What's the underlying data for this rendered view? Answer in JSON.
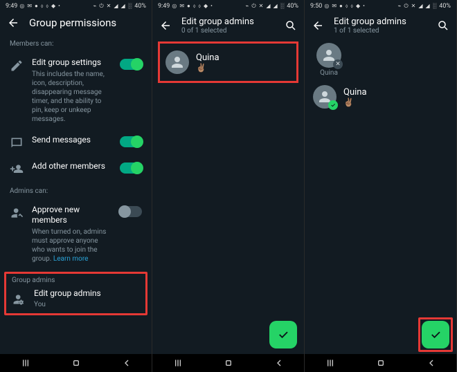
{
  "screens": [
    {
      "status": {
        "time": "9:49",
        "icons": "◎ ✉ ● ⬨ ⬨ ◆ •",
        "right_icons": "⌁ ⏻ ✕ ◢ ◢ ░",
        "battery": "40%"
      },
      "header": {
        "title": "Group permissions"
      },
      "members_label": "Members can:",
      "items": [
        {
          "title": "Edit group settings",
          "desc": "This includes the name, icon, description, disappearing message timer, and the ability to pin, keep or unkeep messages.",
          "toggle": true
        },
        {
          "title": "Send messages",
          "toggle": true
        },
        {
          "title": "Add other members",
          "toggle": true
        }
      ],
      "admins_label": "Admins can:",
      "approve": {
        "title": "Approve new members",
        "desc": "When turned on, admins must approve anyone who wants to join the group.",
        "link": "Learn more",
        "toggle": false
      },
      "group_admins_label": "Group admins",
      "edit_admins": {
        "title": "Edit group admins",
        "sub": "You"
      }
    },
    {
      "status": {
        "time": "9:49",
        "icons": "◎ ✉ ● ⬨ ⬨ ◆ •",
        "right_icons": "⌁ ⏻ ✕ ◢ ◢ ░",
        "battery": "40%"
      },
      "header": {
        "title": "Edit group admins",
        "sub": "0 of 1 selected"
      },
      "contact": {
        "name": "Quina",
        "status": "✌🏽"
      }
    },
    {
      "status": {
        "time": "9:50",
        "icons": "◎ ✉ ● ⬨ ⬨ ◆ •",
        "right_icons": "⌁ ⏻ ✕ ◢ ◢ ░",
        "battery": "40%"
      },
      "header": {
        "title": "Edit group admins",
        "sub": "1 of 1 selected"
      },
      "chip": {
        "name": "Quina"
      },
      "contact": {
        "name": "Quina",
        "status": "✌🏽"
      }
    }
  ]
}
